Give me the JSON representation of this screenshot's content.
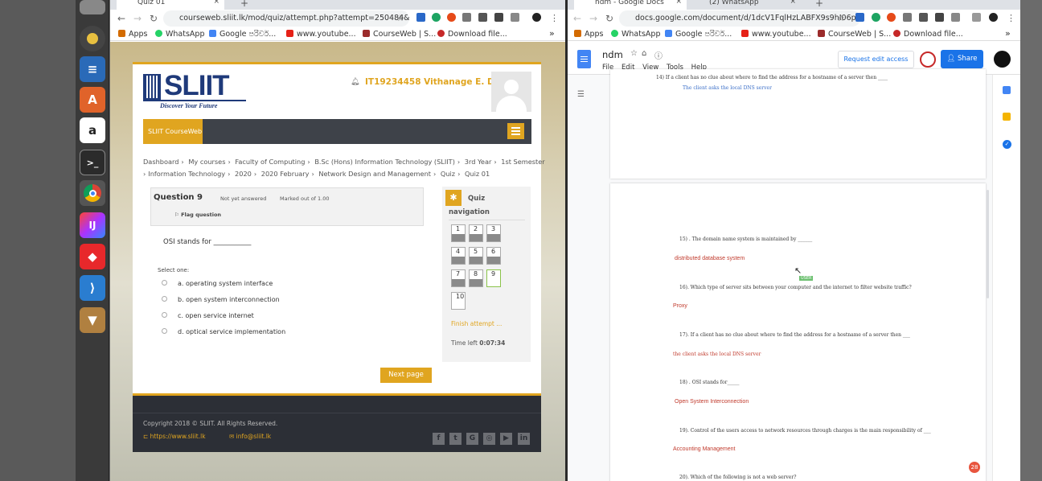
{
  "left_browser": {
    "tabs": [
      {
        "title": "Quiz 01"
      }
    ],
    "url": "courseweb.sliit.lk/mod/quiz/attempt.php?attempt=250484&pag...",
    "bookmarks": [
      "Apps",
      "WhatsApp",
      "Google පරිවර්...",
      "www.youtube...",
      "CourseWeb | S...",
      "Download file..."
    ]
  },
  "moodle": {
    "logo_text": "SLIIT",
    "logo_tagline": "Discover Your Future",
    "user_name": "IT19234458 Vithanage E. D.",
    "site_name": "SLIIT CourseWeb",
    "breadcrumbs_line1": [
      "Dashboard",
      "My courses",
      "Faculty of Computing",
      "B.Sc (Hons) Information Technology (SLIIT)",
      "3rd Year",
      "1st Semester"
    ],
    "breadcrumbs_line2": [
      "Information Technology",
      "2020",
      "2020 February",
      "Network Design and Management",
      "Quiz",
      "Quiz 01"
    ],
    "question": {
      "label": "Question",
      "number": "9",
      "status": "Not yet answered",
      "marks": "Marked out of 1.00",
      "flag": "Flag question",
      "text": "OSI stands for ___________",
      "select_one": "Select one:",
      "options": [
        "a. operating system interface",
        "b. open system interconnection",
        "c. open service internet",
        "d. optical service implementation"
      ]
    },
    "quiz_nav": {
      "title_line1": "Quiz",
      "title_line2": "navigation",
      "numbers": [
        "1",
        "2",
        "3",
        "4",
        "5",
        "6",
        "7",
        "8",
        "9",
        "10"
      ],
      "current": "9",
      "finish": "Finish attempt ...",
      "time_label": "Time left",
      "time_value": "0:07:34"
    },
    "next_button": "Next page",
    "footer": {
      "copyright": "Copyright 2018 © SLIIT. All Rights Reserved.",
      "website": "https://www.sliit.lk",
      "email": "info@sliit.lk",
      "social_icons": [
        "facebook-icon",
        "twitter-icon",
        "google-plus-icon",
        "instagram-icon",
        "youtube-icon",
        "linkedin-icon"
      ]
    }
  },
  "right_browser": {
    "tabs": [
      {
        "title": "ndm - Google Docs"
      },
      {
        "title": "(2) WhatsApp"
      }
    ],
    "url": "docs.google.com/document/d/1dcV1FqlHzLABFX9s9hI06pt...",
    "bookmarks": [
      "Apps",
      "WhatsApp",
      "Google පරිවර්...",
      "www.youtube...",
      "CourseWeb | S...",
      "Download file..."
    ]
  },
  "gdocs": {
    "doc_title": "ndm",
    "menu": [
      "File",
      "Edit",
      "View",
      "Tools",
      "Help"
    ],
    "request_edit": "Request edit access",
    "share": "Share",
    "page1_top_line": "14) If a client has no clue about where to find the address for a hostname of a server then ____",
    "page1_answer": "The client asks the local DNS server",
    "cursor_tag": "USER",
    "notification_count": "28",
    "qa": [
      {
        "q": "15) . The domain name system is maintained by ______",
        "a": "distributed database system"
      },
      {
        "q": "16). Which type of server sits between your computer and the internet to filter website traffic?",
        "a": "Proxy"
      },
      {
        "q": "17). If a client has no clue about where to find the address for a hostname of a server then ___",
        "a": "the client asks the local DNS server"
      },
      {
        "q": "18) . OSI stands for_____",
        "a": "Open System Interconnection"
      },
      {
        "q": "19). Control of the users access to network resources through charges is the main responsibility of ___",
        "a": "Accounting Management"
      },
      {
        "q": "20). Which of the following is not a web server?",
        "a": ""
      }
    ]
  },
  "colors": {
    "accent": "#e0a520",
    "moodle_dark": "#2c2f36",
    "docs_blue": "#1a73e8",
    "answer_red": "#c0392b"
  }
}
